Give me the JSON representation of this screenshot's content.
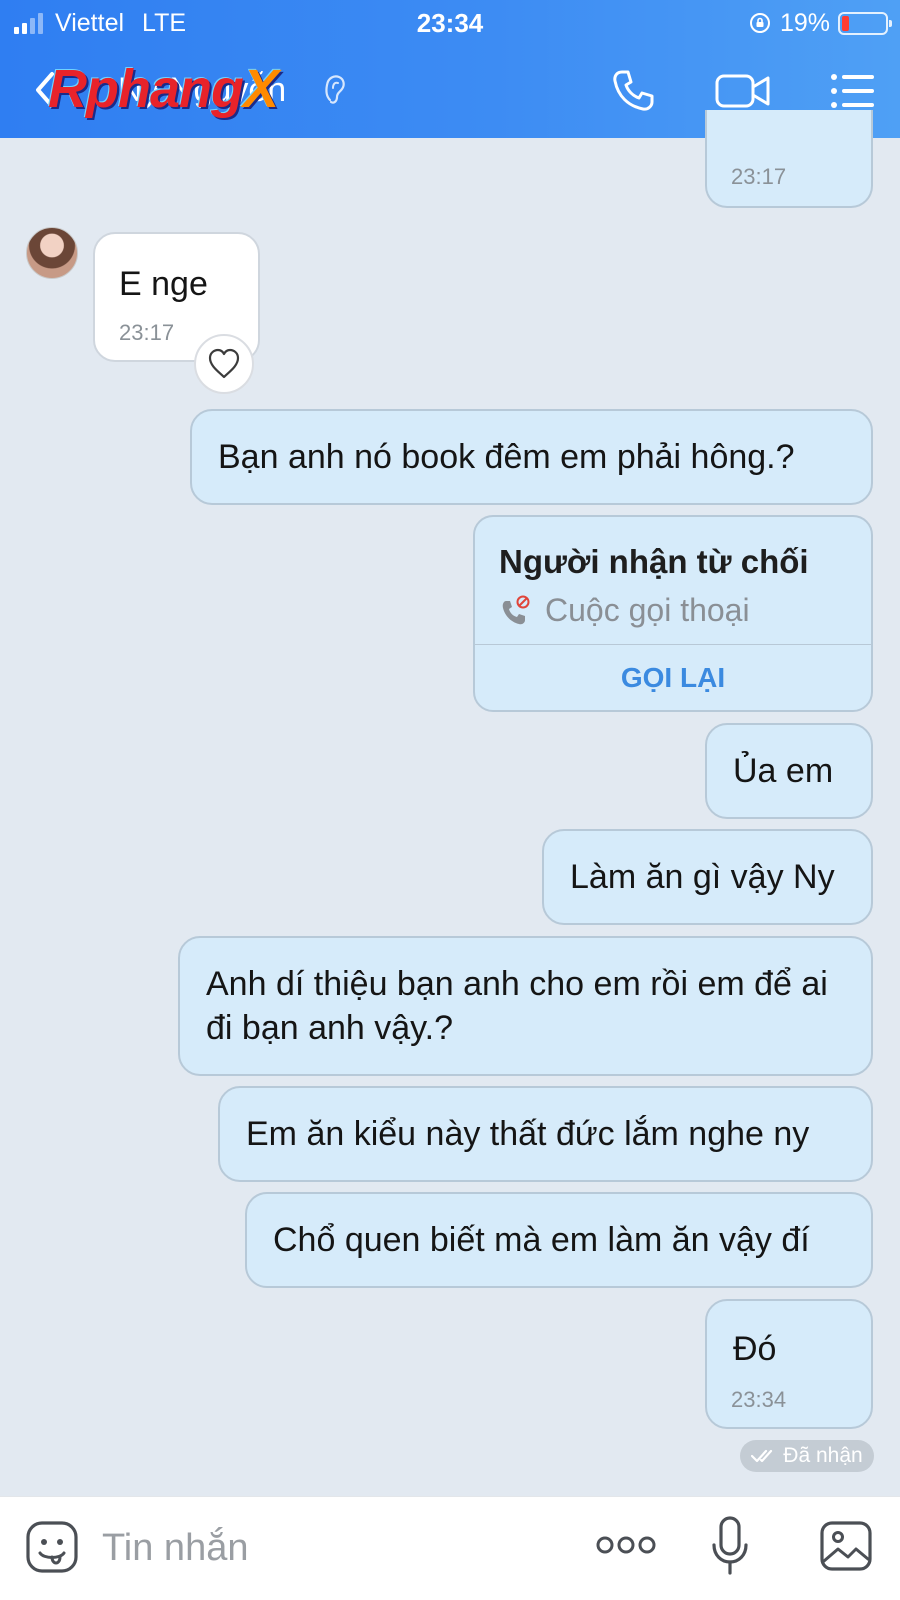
{
  "status_bar": {
    "carrier": "Viettel",
    "network": "LTE",
    "time": "23:34",
    "battery": "19%",
    "battery_color": "#ff3b30"
  },
  "header": {
    "contact_name": "Ny Nguyễn",
    "watermark_main": "Rphang",
    "watermark_suffix": "X",
    "icons": [
      "chevron-left-icon",
      "ear-icon",
      "phone-icon",
      "video-icon",
      "menu-icon"
    ]
  },
  "messages": [
    {
      "text": "",
      "time": "23:17",
      "direction": "out"
    },
    {
      "text": "E nge",
      "time": "23:17",
      "direction": "in"
    },
    {
      "text": "Bạn anh nó book đêm em phải hông.?",
      "direction": "out"
    },
    {
      "text": "Ủa em",
      "direction": "out"
    },
    {
      "text": "Làm ăn gì vậy Ny",
      "direction": "out"
    },
    {
      "text": "Anh dí thiệu bạn anh cho em rồi em để ai đi bạn anh vậy.?",
      "direction": "out"
    },
    {
      "text": "Em ăn kiểu này thất đức lắm nghe ny",
      "direction": "out"
    },
    {
      "text": "Chổ quen biết mà em làm ăn vậy đí",
      "direction": "out"
    },
    {
      "text": "Đó",
      "time": "23:34",
      "direction": "out"
    }
  ],
  "call_card": {
    "title": "Người nhận từ chối",
    "subtitle": "Cuộc gọi thoại",
    "action": "GỌI LẠI"
  },
  "delivery_status": "Đã nhận",
  "composer": {
    "placeholder": "Tin nhắn"
  },
  "colors": {
    "header_blue": "#2f7ef2",
    "outgoing_bubble": "#d6ebfa",
    "chat_background": "#e2e9f1",
    "link_blue": "#3b8ae0"
  }
}
